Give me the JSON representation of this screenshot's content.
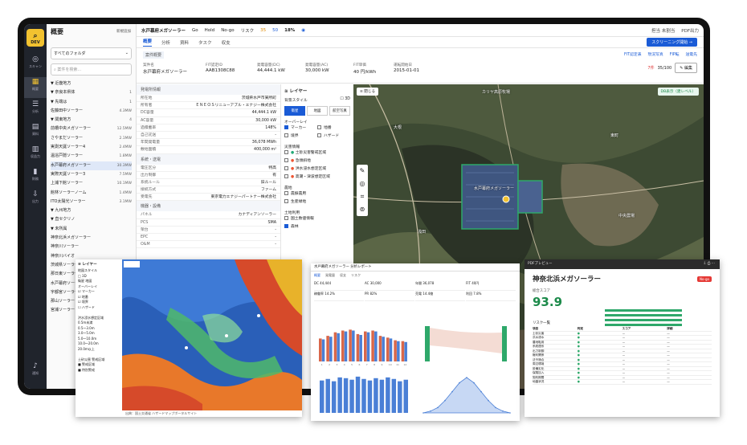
{
  "rail": {
    "logo": "DEV",
    "items": [
      {
        "icon": "map-pin-icon",
        "label": "スキャン"
      },
      {
        "icon": "grid-icon",
        "label": "概要"
      },
      {
        "icon": "database-icon",
        "label": "分析"
      },
      {
        "icon": "file-icon",
        "label": "資料"
      },
      {
        "icon": "table-icon",
        "label": "収益力"
      },
      {
        "icon": "chart-icon",
        "label": "財務"
      },
      {
        "icon": "download-icon",
        "label": "出力"
      },
      {
        "icon": "bell-icon",
        "label": "通知"
      }
    ]
  },
  "tree": {
    "title": "概要",
    "add_folder": "新規追加",
    "folder_select": "すべてのフォルダ",
    "search_placeholder": "案件を検索...",
    "rows": [
      {
        "label": "▼ 近畿地方",
        "value": ""
      },
      {
        "label": "  ▼ 奈良本県体",
        "value": "1"
      },
      {
        "label": "    ▼ 先端は",
        "value": "1"
      },
      {
        "label": "      佐藤田中ソーラー",
        "value": "4.3MW"
      },
      {
        "label": "  ▼ 関東地方",
        "value": "4"
      },
      {
        "label": "      前橋中央メガソーラー",
        "value": "12.5MW"
      },
      {
        "label": "      さやまだソーラー",
        "value": "2.1MW"
      },
      {
        "label": "      実測天誕ソーラー4",
        "value": "2.4MW"
      },
      {
        "label": "      温浴戸隠ソーラー",
        "value": "1.8MW"
      },
      {
        "label": "      水戸幕府メガソーラー",
        "value": "30.3MW"
      },
      {
        "label": "      実際天誕ソーラー3",
        "value": "7.5MW"
      },
      {
        "label": "      上浦下館ソーラー",
        "value": "10.1MW"
      },
      {
        "label": "      館林ソーラーノーム",
        "value": "1.4MW"
      },
      {
        "label": "      ITO太陽光ソーラー",
        "value": "3.1MW"
      },
      {
        "label": "▼ 九州地方",
        "value": ""
      },
      {
        "label": "▼ 直セクリノ",
        "value": ""
      },
      {
        "label": "▼ 未所属",
        "value": ""
      },
      {
        "label": "  神奈北浜メガソーラー",
        "value": ""
      },
      {
        "label": "  神奈川ソーラー",
        "value": ""
      },
      {
        "label": "  神奈川バイオ",
        "value": ""
      },
      {
        "label": "  茨城県ソーラー",
        "value": ""
      },
      {
        "label": "  那日東ソーラー",
        "value": ""
      },
      {
        "label": "  水戸幕府ソーラー",
        "value": ""
      },
      {
        "label": "  宇都宮ソーラー",
        "value": ""
      },
      {
        "label": "  那山ソーラー",
        "value": ""
      },
      {
        "label": "  宮浦ソーラー",
        "value": ""
      }
    ]
  },
  "topbar": {
    "title": "水戸幕府メガソーラー",
    "flags": [
      "Go",
      "Hold",
      "No-go"
    ],
    "score_label": "リスク",
    "score_values": [
      "35",
      "50"
    ],
    "pct": "18%",
    "right": [
      "担当 未割当",
      "PDF出力"
    ]
  },
  "tabs": [
    "概要",
    "分析",
    "資料",
    "タスク",
    "収支"
  ],
  "cta": "スクリーニング開始 →",
  "summary": {
    "section": "案件概要",
    "links": [
      "FIT認定表",
      "現況写真",
      "FIP転",
      "送電先"
    ],
    "fields": [
      {
        "k": "案件名",
        "v": "水戸幕府メガソーラー"
      },
      {
        "k": "FIT認定ID",
        "v": "AAB1308C88"
      },
      {
        "k": "発電容量(DC)",
        "v": "44,444.1 kW"
      },
      {
        "k": "発電容量(AC)",
        "v": "30,000 kW"
      },
      {
        "k": "FIT単価",
        "v": "40 円/kWh"
      },
      {
        "k": "運転開始日",
        "v": "2015-01-01"
      }
    ],
    "badge": "7件",
    "risk": "35/100",
    "edit": "編集"
  },
  "props": {
    "section1": "発電所情報",
    "rows1": [
      {
        "k": "所在地",
        "v": "茨城県水戸市某所町"
      },
      {
        "k": "所有者",
        "v": "ＥＮＥＯＳリニューアブル・エナジー株式会社"
      },
      {
        "k": "DC容量",
        "v": "44,444.1 kW"
      },
      {
        "k": "AC容量",
        "v": "30,000 kW"
      },
      {
        "k": "過積載率",
        "v": "148%"
      },
      {
        "k": "自己託送",
        "v": "-"
      },
      {
        "k": "年間発電量",
        "v": "36,078 MWh"
      },
      {
        "k": "敷地面積",
        "v": "400,000 m²"
      }
    ],
    "section2": "系統・送電",
    "rows2": [
      {
        "k": "電圧区分",
        "v": "特高"
      },
      {
        "k": "出力制御",
        "v": "有"
      },
      {
        "k": "系統ルール",
        "v": "旧ルール"
      },
      {
        "k": "接続方式",
        "v": "ファーム"
      },
      {
        "k": "受電先",
        "v": "東京電力エナジーパートナー株式会社"
      }
    ],
    "section3": "機器・設備",
    "rows3": [
      {
        "k": "パネル",
        "v": "カナディアンソーラー"
      },
      {
        "k": "PCS",
        "v": "SMA"
      },
      {
        "k": "架台",
        "v": "-"
      },
      {
        "k": "EPC",
        "v": "-"
      },
      {
        "k": "O&M",
        "v": "-"
      }
    ]
  },
  "layers": {
    "title": "レイヤー",
    "base_label": "背景スタイル",
    "toggle_3d": "3D",
    "styles": [
      "衛星",
      "地図",
      "航空写真"
    ],
    "overlay_label": "オーバーレイ",
    "overlays": [
      {
        "label": "マーカー",
        "on": true
      },
      {
        "label": "地番",
        "on": false
      },
      {
        "label": "境界",
        "on": false
      },
      {
        "label": "ハザード",
        "on": false
      }
    ],
    "hazard_label": "災害情報",
    "hazards": [
      "土砂災害警戒区域",
      "急傾斜地",
      "洪水浸水想定区域",
      "高潮・津波想定区域"
    ],
    "land_label": "農地",
    "land": [
      "農振農用",
      "生産緑地"
    ],
    "use_label": "土地利用",
    "use": [
      "国土数値情報",
      "森林"
    ]
  },
  "map": {
    "toggle": "≡ 閉じる",
    "mode": "DB表示（建レベル）",
    "places": [
      "カリヤ高原牧場",
      "水戸幕府メガソーラー",
      "中央農場",
      "大根",
      "浅田",
      "東町"
    ]
  },
  "hazard_card": {
    "title": "レイヤー",
    "rows": [
      "地図スタイル",
      "□ 3D",
      "衛星  地図",
      "オーバーレイ",
      "☑ マーカー",
      "☑ 地番",
      "☑ 境界",
      "☐ ハザード",
      "",
      "洪水浸水想定区域",
      "0.5m未満",
      "0.5〜3.0m",
      "3.0〜5.0m",
      "5.0〜10.0m",
      "10.0〜20.0m",
      "20.0m以上",
      "",
      "土砂災害 警戒区域",
      "■ 警戒区域",
      "■ 特別警戒"
    ],
    "footer": "出典：国土交通省 ハザードマップポータルサイト"
  },
  "dash_card": {
    "header": "水戸幕府メガソーラー 分析レポート",
    "tabs": [
      "概要",
      "発電量",
      "収支",
      "リスク"
    ],
    "kpis": [
      "DC 44,444",
      "AC 30,000",
      "年間 36,078",
      "FIT 40円",
      "稼働率 14.2%",
      "PR 82%",
      "売電 14.4億",
      "利回 7.8%"
    ],
    "bar_title": "月別発電量",
    "line_title": "日射量推移"
  },
  "pdf_card": {
    "bar": "PDFプレビュー",
    "title": "神奈北浜メガソーラー",
    "badge": "No-go",
    "score_label": "総合スコア",
    "score": "93.9",
    "table_title": "リスク一覧",
    "table_head": [
      "項目",
      "判定",
      "スコア",
      "詳細"
    ],
    "table_rows": [
      "土砂災害",
      "洪水浸水",
      "農地転用",
      "系統連系",
      "出力制御",
      "権利関係",
      "法令適合",
      "周辺環境",
      "設備劣化",
      "保険加入",
      "契約期間",
      "地盤状況"
    ]
  },
  "chart_data": [
    {
      "type": "bar",
      "title": "月別発電量",
      "categories": [
        "1",
        "2",
        "3",
        "4",
        "5",
        "6",
        "7",
        "8",
        "9",
        "10",
        "11",
        "12"
      ],
      "series": [
        {
          "values": [
            2.6,
            2.9,
            3.3,
            3.5,
            3.6,
            3.1,
            3.4,
            3.5,
            2.9,
            2.7,
            2.4,
            2.3
          ]
        },
        {
          "values": [
            2.5,
            2.8,
            3.2,
            3.4,
            3.5,
            3.0,
            3.3,
            3.4,
            2.8,
            2.6,
            2.3,
            2.2
          ]
        }
      ]
    },
    {
      "type": "bar",
      "title": "年次別発電量",
      "categories": [
        "1",
        "2",
        "3",
        "4",
        "5",
        "6",
        "7",
        "8",
        "9",
        "10",
        "11",
        "12",
        "13",
        "14",
        "15"
      ],
      "values": [
        4.2,
        4.4,
        4.1,
        4.6,
        4.5,
        4.3,
        4.7,
        4.4,
        4.2,
        4.5,
        4.3,
        4.6,
        4.4,
        4.1,
        4.3
      ]
    },
    {
      "type": "area",
      "title": "日射量推移",
      "x": [
        0,
        1,
        2,
        3,
        4,
        5,
        6,
        7,
        8,
        9,
        10,
        11,
        12
      ],
      "values": [
        0,
        0.05,
        0.15,
        0.35,
        0.6,
        0.85,
        1.0,
        0.85,
        0.6,
        0.35,
        0.15,
        0.05,
        0
      ]
    }
  ],
  "colors": {
    "accent": "#1a5bd6",
    "sidebar": "#20242c",
    "logo": "#f2c230",
    "pv_green": "#2ea86a",
    "bar_red": "#d9674a",
    "bar_blue": "#4a7fd6"
  }
}
